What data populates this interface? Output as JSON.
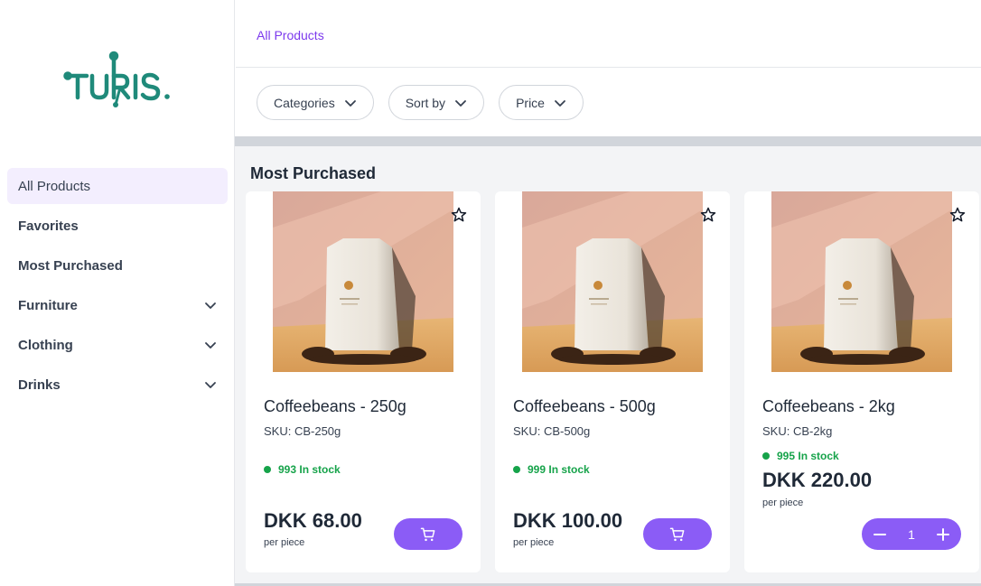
{
  "brand": {
    "name": "TURIS.",
    "color": "#1f8a7a"
  },
  "sidebar": {
    "items": [
      {
        "label": "All Products",
        "active": true,
        "expandable": false
      },
      {
        "label": "Favorites",
        "active": false,
        "expandable": false
      },
      {
        "label": "Most Purchased",
        "active": false,
        "expandable": false
      },
      {
        "label": "Furniture",
        "active": false,
        "expandable": true
      },
      {
        "label": "Clothing",
        "active": false,
        "expandable": true
      },
      {
        "label": "Drinks",
        "active": false,
        "expandable": true
      }
    ]
  },
  "breadcrumb": {
    "label": "All Products"
  },
  "filters": [
    {
      "label": "Categories"
    },
    {
      "label": "Sort by"
    },
    {
      "label": "Price"
    }
  ],
  "section": {
    "title": "Most Purchased"
  },
  "products": [
    {
      "name": "Coffeebeans - 250g",
      "sku": "SKU: CB-250g",
      "stock": "993 In stock",
      "price": "DKK 68.00",
      "unit": "per piece",
      "in_cart": false
    },
    {
      "name": "Coffeebeans - 500g",
      "sku": "SKU: CB-500g",
      "stock": "999 In stock",
      "price": "DKK 100.00",
      "unit": "per piece",
      "in_cart": false
    },
    {
      "name": "Coffeebeans - 2kg",
      "sku": "SKU: CB-2kg",
      "stock": "995 In stock",
      "price": "DKK 220.00",
      "unit": "per piece",
      "in_cart": true,
      "quantity": "1"
    }
  ],
  "colors": {
    "accent": "#8b5cf6",
    "link": "#7c3aed",
    "stock": "#16a34a",
    "active_nav_bg": "#f3eefe"
  },
  "icons": [
    "chevron-down-icon",
    "star-icon",
    "cart-icon",
    "minus-icon",
    "plus-icon"
  ]
}
